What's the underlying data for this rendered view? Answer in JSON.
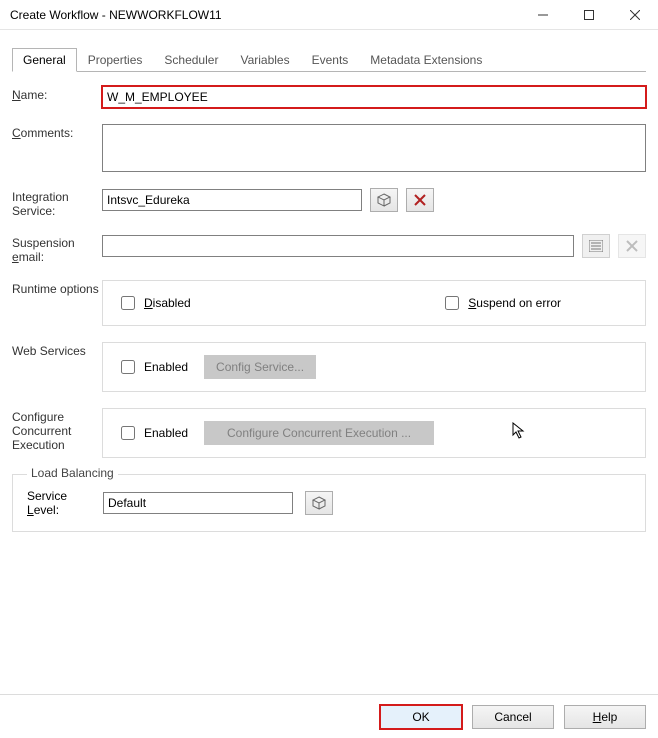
{
  "window": {
    "title": "Create Workflow - NEWWORKFLOW11"
  },
  "tabs": [
    "General",
    "Properties",
    "Scheduler",
    "Variables",
    "Events",
    "Metadata Extensions"
  ],
  "activeTab": "General",
  "labels": {
    "name": "Name:",
    "comments": "Comments:",
    "integration": "Integration Service:",
    "suspension": "Suspension email:",
    "runtime": "Runtime options",
    "webservices": "Web Services",
    "concurrent": "Configure Concurrent Execution",
    "servicelevel": "Service Level:",
    "loadbalancing": "Load Balancing"
  },
  "values": {
    "name": "W_M_EMPLOYEE",
    "comments": "",
    "integrationService": "Intsvc_Edureka",
    "suspensionEmail": "",
    "serviceLevel": "Default"
  },
  "checks": {
    "disabled": "Disabled",
    "suspendOnError": "Suspend on error",
    "enabledWeb": "Enabled",
    "enabledConcurrent": "Enabled"
  },
  "buttons": {
    "configService": "Config Service...",
    "configConcurrent": "Configure Concurrent Execution ...",
    "ok": "OK",
    "cancel": "Cancel",
    "help": "Help"
  }
}
